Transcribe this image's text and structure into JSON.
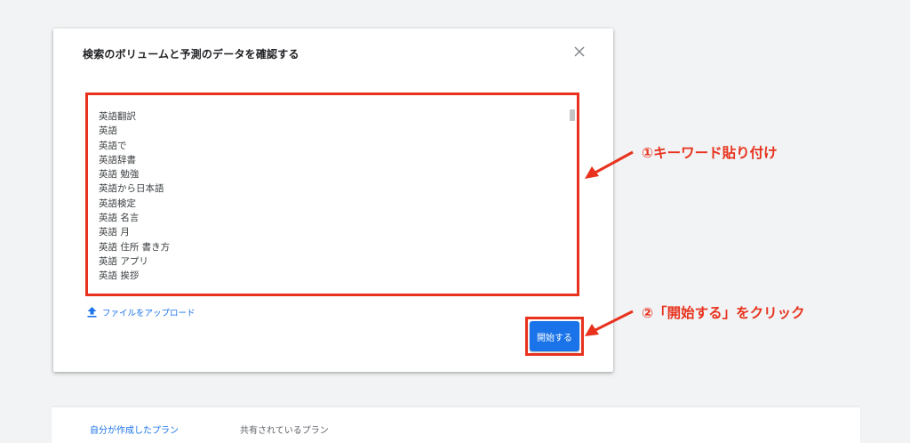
{
  "dialog": {
    "title": "検索のボリュームと予測のデータを確認する",
    "keywords": [
      "英語翻訳",
      "英語",
      "英語で",
      "英語辞書",
      "英語 勉強",
      "英語から日本語",
      "英語検定",
      "英語 名言",
      "英語 月",
      "英語 住所 書き方",
      "英語 アプリ",
      "英語 挨拶"
    ],
    "upload_label": "ファイルをアップロード",
    "start_label": "開始する"
  },
  "annotations": {
    "step1": "①キーワード貼り付け",
    "step2": "②「開始する」をクリック"
  },
  "tabs": {
    "own": "自分が作成したプラン",
    "shared": "共有されているプラン"
  },
  "colors": {
    "highlight": "#e8321e",
    "primary": "#1a73e8",
    "background": "#f1f3f4"
  },
  "icons": {
    "close": "close-icon",
    "upload": "upload-icon",
    "arrow": "arrow-left-icon"
  }
}
